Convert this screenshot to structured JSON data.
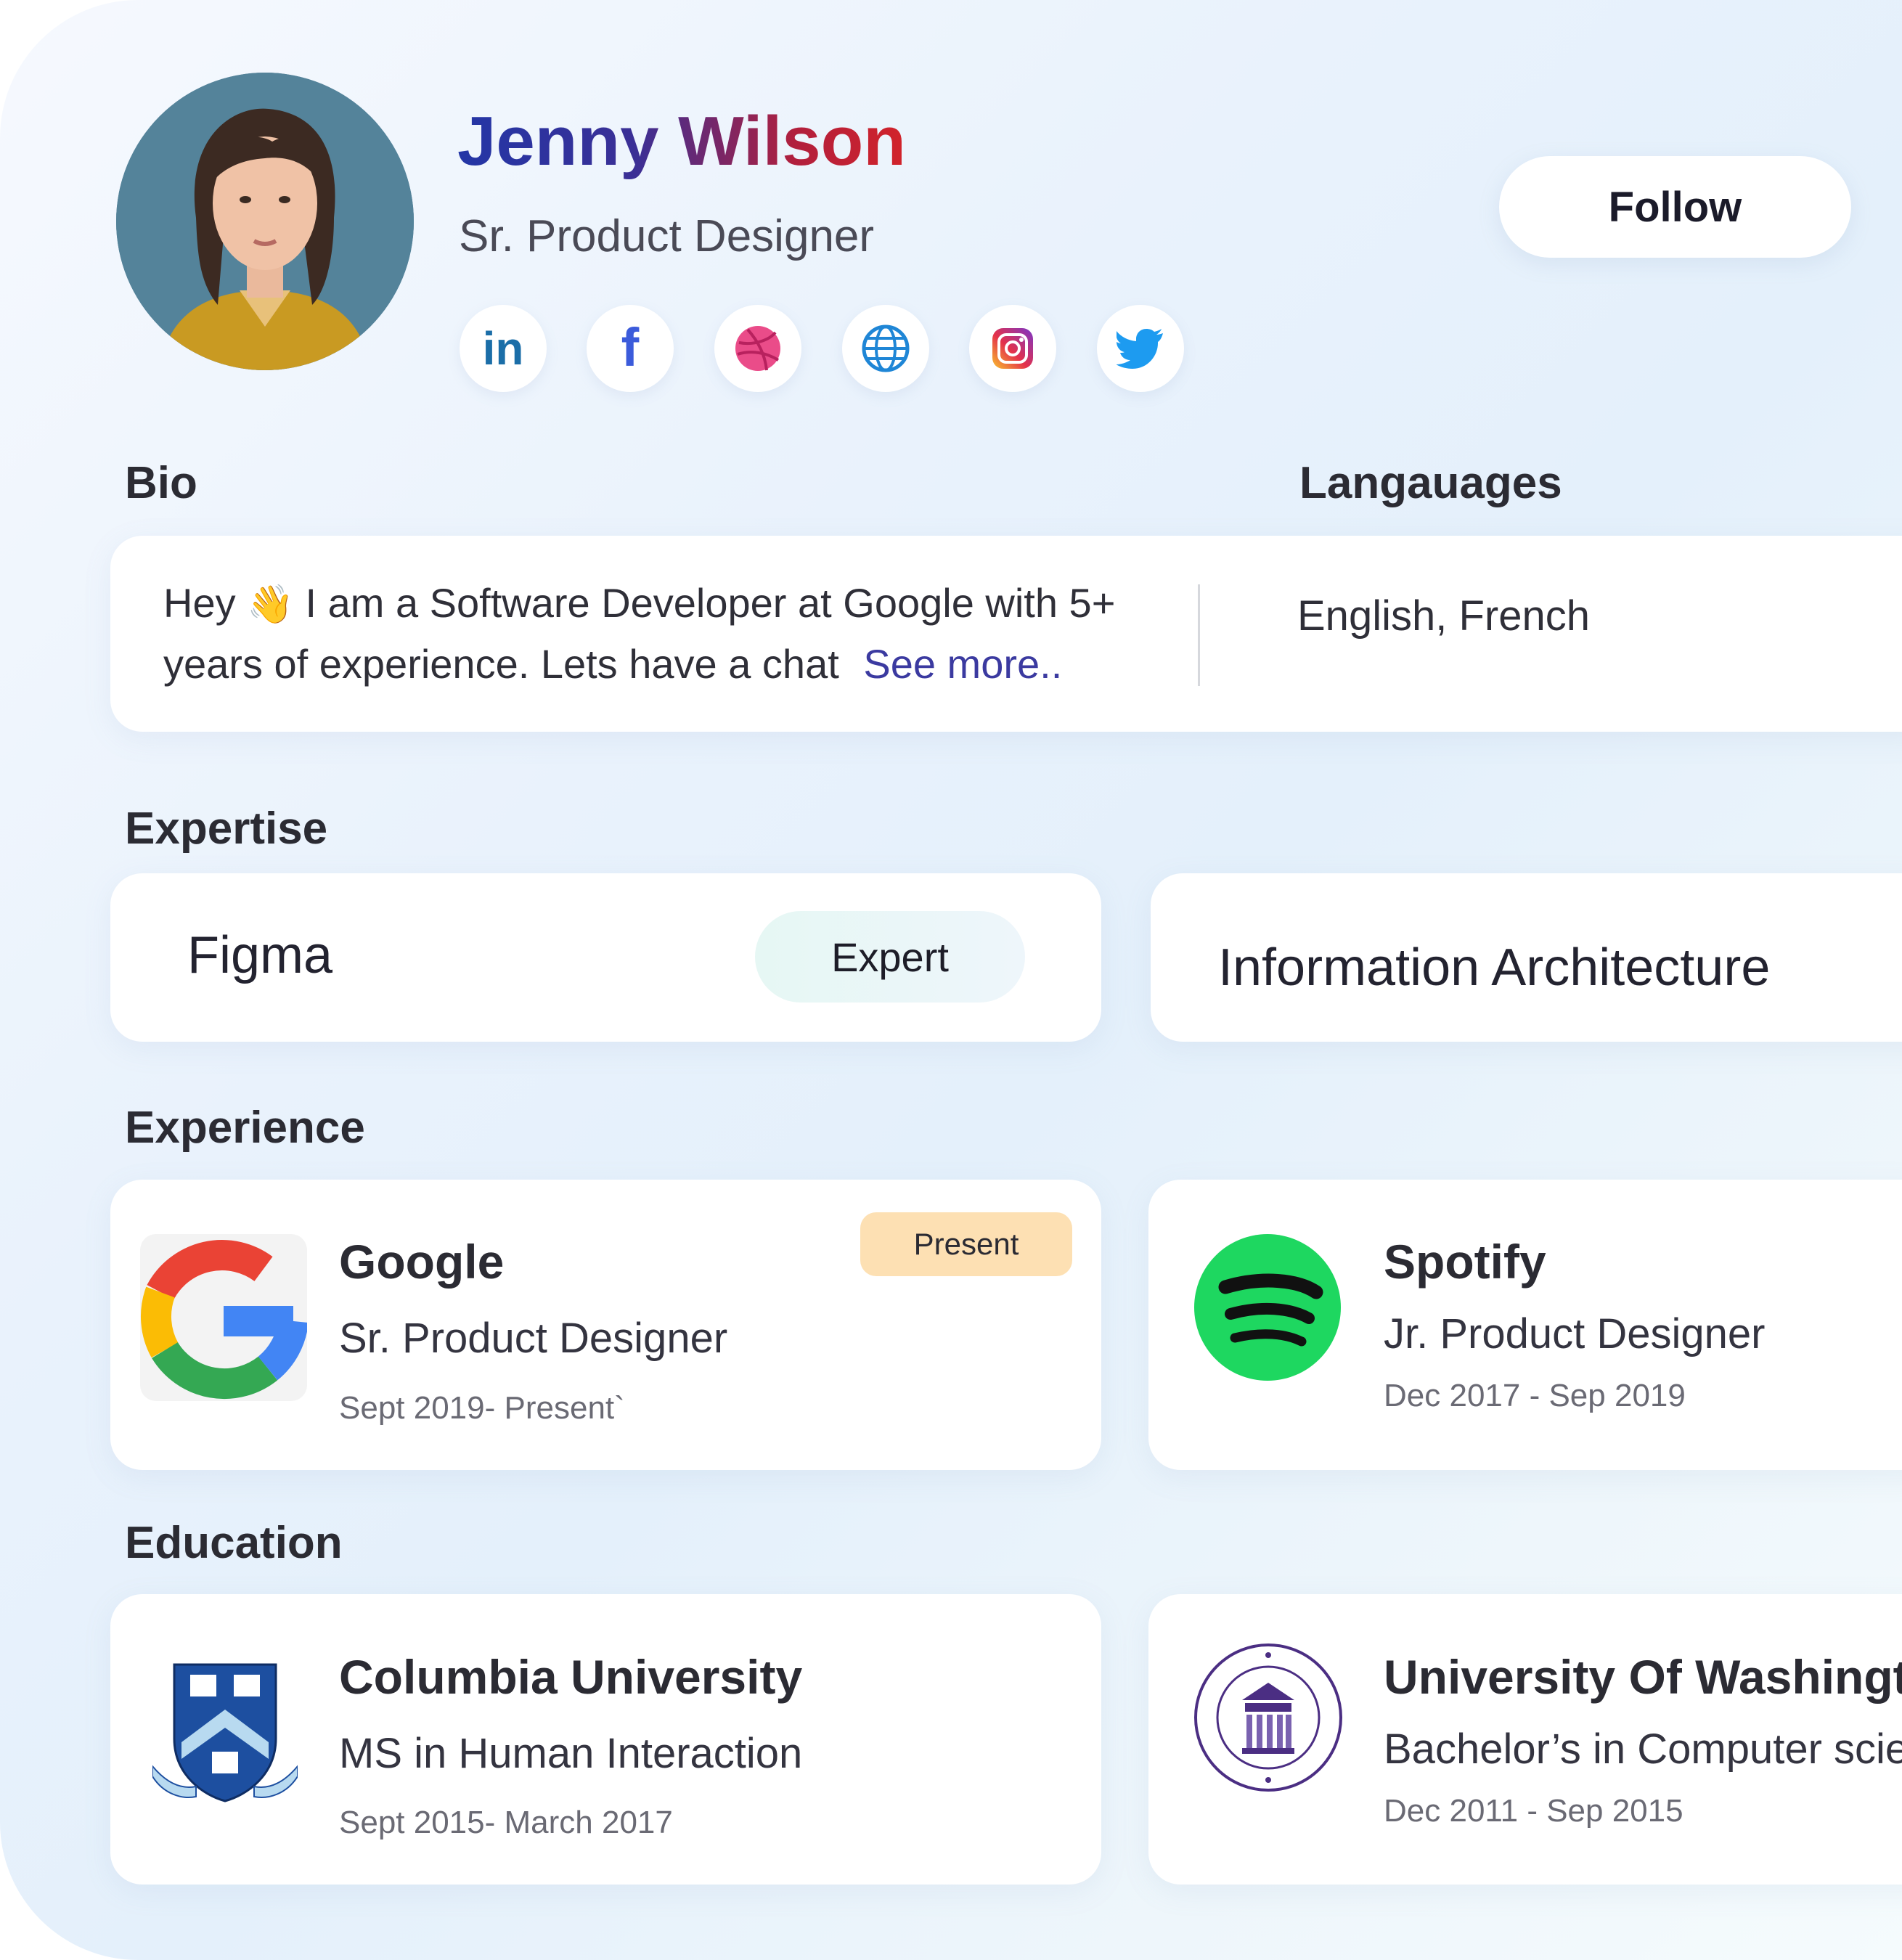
{
  "profile": {
    "name": "Jenny Wilson",
    "role": "Sr. Product Designer",
    "follow_label": "Follow",
    "socials": [
      "linkedin-icon",
      "facebook-icon",
      "dribbble-icon",
      "globe-icon",
      "instagram-icon",
      "twitter-icon"
    ]
  },
  "bio": {
    "title": "Bio",
    "text_before": "Hey",
    "wave": "👋",
    "text_after": " I am a Software Developer at Google with 5+ years of experience. Lets have a chat",
    "see_more": "See more.."
  },
  "languages": {
    "title": "Langauages",
    "value": "English, French"
  },
  "expertise": {
    "title": "Expertise",
    "items": [
      {
        "name": "Figma",
        "level": "Expert"
      },
      {
        "name": "Information Architecture"
      }
    ]
  },
  "experience": {
    "title": "Experience",
    "items": [
      {
        "company": "Google",
        "role": "Sr. Product Designer",
        "dates": "Sept 2019- Present`",
        "badge": "Present"
      },
      {
        "company": "Spotify",
        "role": "Jr. Product Designer",
        "dates": "Dec 2017 - Sep 2019"
      }
    ]
  },
  "education": {
    "title": "Education",
    "items": [
      {
        "school": "Columbia University",
        "degree": "MS in Human Interaction",
        "dates": "Sept 2015- March 2017"
      },
      {
        "school": "University Of Washingt",
        "degree": "Bachelor’s in Computer scier",
        "dates": "Dec 2011 - Sep 2015"
      }
    ]
  },
  "colors": {
    "name_gradient_start": "#2336a6",
    "name_gradient_end": "#d2232a",
    "link": "#3b3aa0",
    "present_badge": "#fde0b3",
    "spotify": "#1ed760"
  }
}
